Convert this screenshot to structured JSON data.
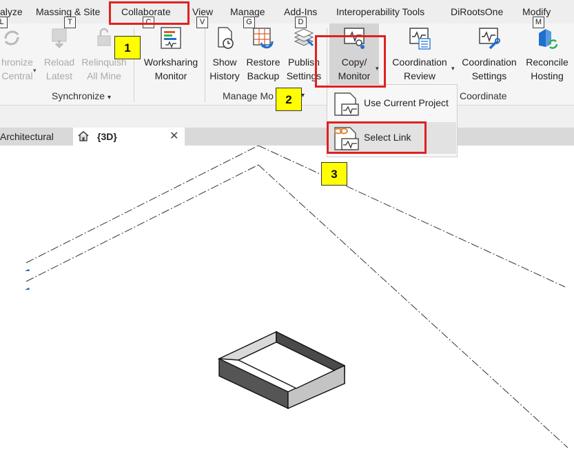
{
  "ribbon_tabs": [
    {
      "label": "alyze"
    },
    {
      "label": "Massing & Site"
    },
    {
      "label": "Collaborate"
    },
    {
      "label": "View"
    },
    {
      "label": "Manage"
    },
    {
      "label": "Add-Ins"
    },
    {
      "label": "Interoperability Tools"
    },
    {
      "label": "DiRootsOne"
    },
    {
      "label": "Modify"
    }
  ],
  "keytips": [
    "L",
    "T",
    "C",
    "V",
    "G",
    "D",
    "M"
  ],
  "buttons": {
    "sync_central": {
      "line1": "hronize",
      "line2": "Central"
    },
    "reload_latest": {
      "line1": "Reload",
      "line2": "Latest"
    },
    "relinquish": {
      "line1": "Relinquish",
      "line2": "All Mine"
    },
    "worksharing_monitor": {
      "line1": "Worksharing",
      "line2": "Monitor"
    },
    "show_history": {
      "line1": "Show",
      "line2": "History"
    },
    "restore_backup": {
      "line1": "Restore",
      "line2": "Backup"
    },
    "publish_settings": {
      "line1": "Publish",
      "line2": "Settings"
    },
    "copy_monitor": {
      "line1": "Copy/",
      "line2": "Monitor"
    },
    "coordination_review": {
      "line1": "Coordination",
      "line2": "Review"
    },
    "coordination_settings": {
      "line1": "Coordination",
      "line2": "Settings"
    },
    "reconcile_hosting": {
      "line1": "Reconcile",
      "line2": "Hosting"
    }
  },
  "panels": {
    "synchronize": "Synchronize",
    "manage_models": "Manage Mo",
    "coordinate": "Coordinate"
  },
  "dropdown": {
    "use_current_project": "Use Current Project",
    "select_link": "Select Link"
  },
  "view_tabs": {
    "architectural": "Architectural",
    "three_d": "{3D}",
    "close_glyph": "✕"
  },
  "callouts": [
    "1",
    "2",
    "3"
  ],
  "colors": {
    "highlight_red": "#e02020",
    "badge_yellow": "#ffff00",
    "accent_blue": "#1e6fd0",
    "accent_green": "#2bb24c",
    "accent_orange": "#e0893a"
  }
}
